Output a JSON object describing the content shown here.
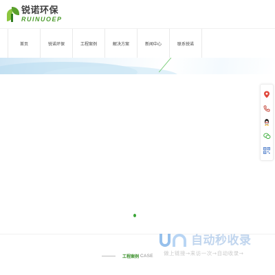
{
  "brand": {
    "name_cn": "锐诺环保",
    "name_en": "RUINUOEP"
  },
  "nav": {
    "items": [
      {
        "label": "首页"
      },
      {
        "label": "锐诺环保"
      },
      {
        "label": "工程案例"
      },
      {
        "label": "解决方案"
      },
      {
        "label": "新闻中心"
      },
      {
        "label": "联系锐诺"
      }
    ]
  },
  "slider": {
    "active_index": 0,
    "dot_color": "#3aa536"
  },
  "floating_toolbar": {
    "buttons": [
      {
        "icon": "location-pin-icon"
      },
      {
        "icon": "phone-icon"
      },
      {
        "icon": "qq-icon"
      },
      {
        "icon": "wechat-icon"
      },
      {
        "icon": "qr-code-icon"
      }
    ]
  },
  "section": {
    "title_cn": "工程案例",
    "title_en": "CASE"
  },
  "watermark": {
    "title": "自动秒收录",
    "subtitle": "做上链接→来访一次→自动收录→"
  },
  "colors": {
    "brand_green": "#4a9a2a",
    "accent_green": "#3a8f2a",
    "nav_border": "#e9e9e9"
  }
}
